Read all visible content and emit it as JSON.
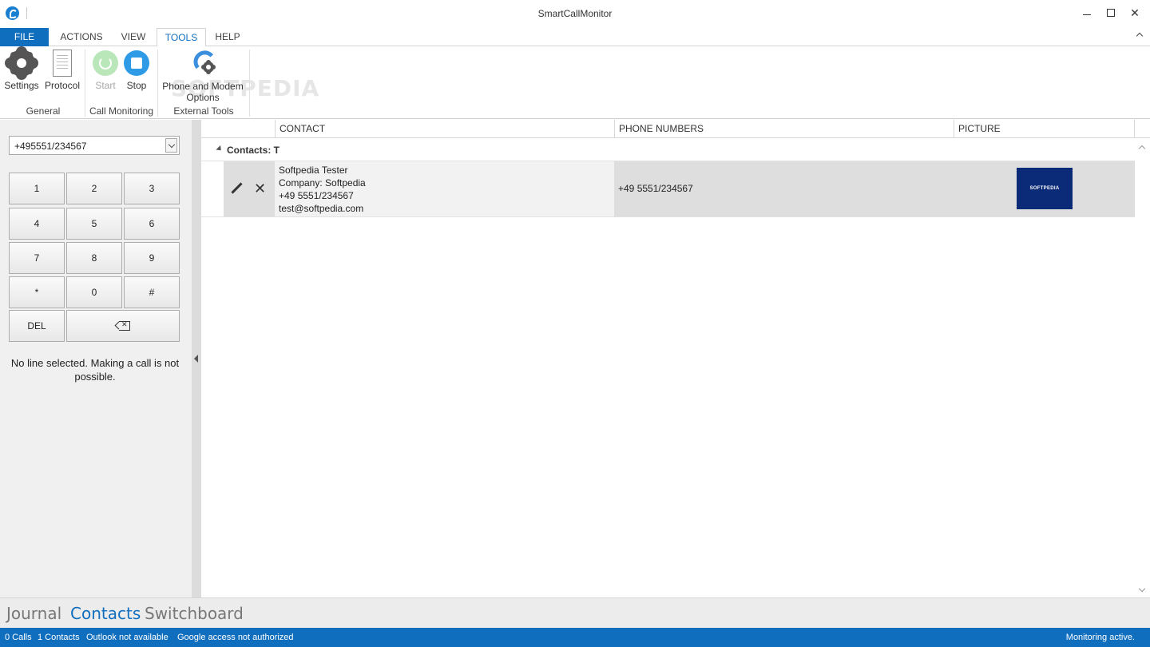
{
  "window": {
    "title": "SmartCallMonitor"
  },
  "menu": {
    "file": "FILE",
    "actions": "ACTIONS",
    "view": "VIEW",
    "tools": "TOOLS",
    "help": "HELP",
    "active_tab": "TOOLS"
  },
  "ribbon": {
    "general": {
      "label": "General",
      "settings": "Settings",
      "protocol": "Protocol"
    },
    "call_monitoring": {
      "label": "Call Monitoring",
      "start": "Start",
      "stop": "Stop"
    },
    "external_tools": {
      "label": "External Tools",
      "phone_modem_line1": "Phone and Modem",
      "phone_modem_line2": "Options"
    },
    "watermark": "SOFTPEDIA"
  },
  "dialer": {
    "number_value": "+495551/234567",
    "keys": [
      "1",
      "2",
      "3",
      "4",
      "5",
      "6",
      "7",
      "8",
      "9",
      "*",
      "0",
      "#"
    ],
    "del_label": "DEL",
    "status_text": "No line selected. Making a call is not possible."
  },
  "contacts_grid": {
    "columns": [
      "CONTACT",
      "PHONE NUMBERS",
      "PICTURE"
    ],
    "group_label": "Contacts: T",
    "rows": [
      {
        "name": "Softpedia Tester",
        "company": "Company: Softpedia",
        "phone": "+49 5551/234567",
        "email": "test@softpedia.com",
        "phone_numbers": "+49 5551/234567",
        "picture_text": "SOFTPEDIA"
      }
    ]
  },
  "bottom_nav": {
    "tabs": [
      "Journal",
      "Contacts",
      "Switchboard"
    ],
    "active": "Contacts"
  },
  "status_bar": {
    "calls": "0 Calls",
    "contacts": "1 Contacts",
    "outlook": "Outlook not available",
    "google": "Google access not authorized",
    "monitoring": "Monitoring active."
  },
  "colors": {
    "accent": "#106ebe",
    "picture_bg": "#0b2a78"
  }
}
